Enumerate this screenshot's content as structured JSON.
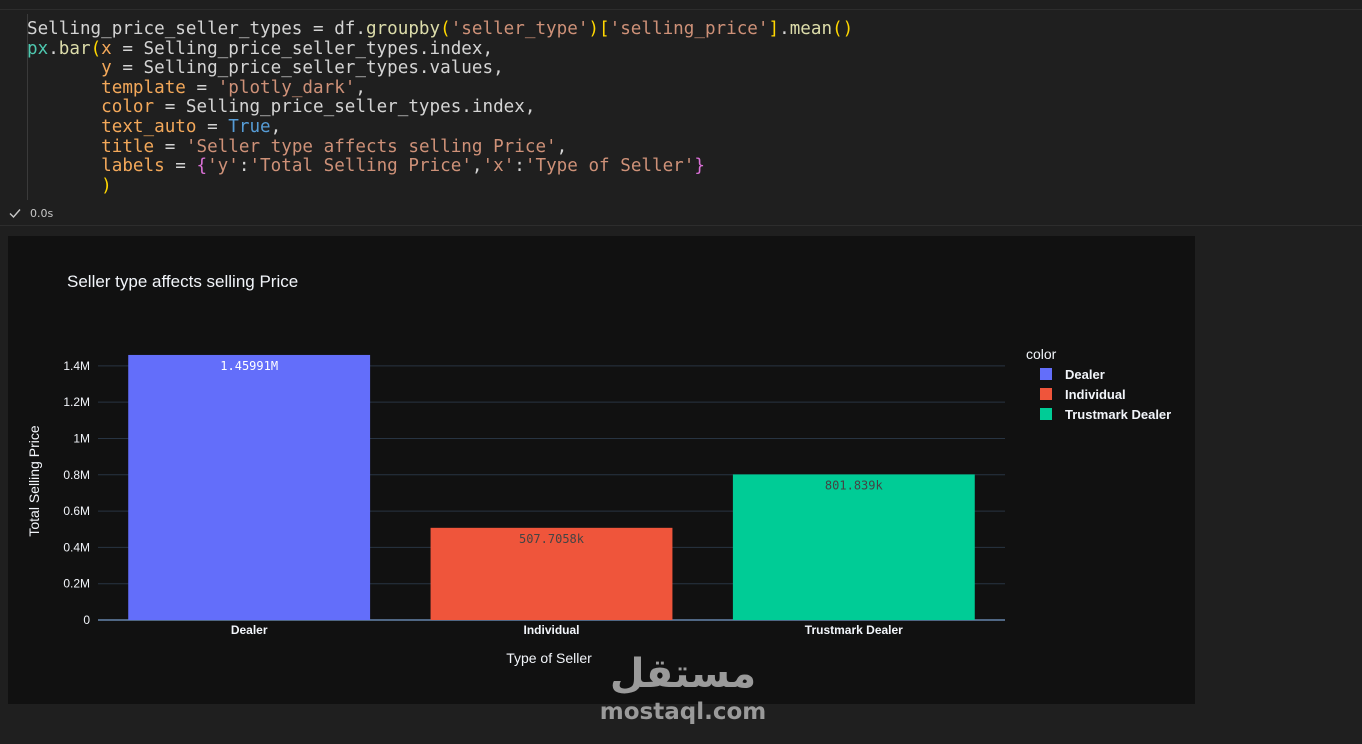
{
  "code": {
    "lines": [
      [
        {
          "t": "Selling_price_seller_types ",
          "c": "tok-var"
        },
        {
          "t": "= ",
          "c": "tok-var"
        },
        {
          "t": "df.",
          "c": "tok-var"
        },
        {
          "t": "groupby",
          "c": "tok-fn"
        },
        {
          "t": "(",
          "c": "tok-br1"
        },
        {
          "t": "'seller_type'",
          "c": "tok-str"
        },
        {
          "t": ")",
          "c": "tok-br1"
        },
        {
          "t": "[",
          "c": "tok-br1"
        },
        {
          "t": "'selling_price'",
          "c": "tok-str"
        },
        {
          "t": "]",
          "c": "tok-br1"
        },
        {
          "t": ".",
          "c": "tok-var"
        },
        {
          "t": "mean",
          "c": "tok-fn"
        },
        {
          "t": "()",
          "c": "tok-br1"
        }
      ],
      [
        {
          "t": "px",
          "c": "tok-py"
        },
        {
          "t": ".",
          "c": "tok-var"
        },
        {
          "t": "bar",
          "c": "tok-fn"
        },
        {
          "t": "(",
          "c": "tok-br1"
        },
        {
          "t": "x",
          "c": "tok-arg"
        },
        {
          "t": " = Selling_price_seller_types.index,",
          "c": "tok-var"
        }
      ],
      [
        {
          "t": "       ",
          "c": "tok-var"
        },
        {
          "t": "y",
          "c": "tok-arg"
        },
        {
          "t": " = Selling_price_seller_types.values,",
          "c": "tok-var"
        }
      ],
      [
        {
          "t": "       ",
          "c": "tok-var"
        },
        {
          "t": "template",
          "c": "tok-arg"
        },
        {
          "t": " = ",
          "c": "tok-var"
        },
        {
          "t": "'plotly_dark'",
          "c": "tok-str"
        },
        {
          "t": ",",
          "c": "tok-var"
        }
      ],
      [
        {
          "t": "       ",
          "c": "tok-var"
        },
        {
          "t": "color",
          "c": "tok-arg"
        },
        {
          "t": " = Selling_price_seller_types.index,",
          "c": "tok-var"
        }
      ],
      [
        {
          "t": "       ",
          "c": "tok-var"
        },
        {
          "t": "text_auto",
          "c": "tok-arg"
        },
        {
          "t": " = ",
          "c": "tok-var"
        },
        {
          "t": "True",
          "c": "tok-const"
        },
        {
          "t": ",",
          "c": "tok-var"
        }
      ],
      [
        {
          "t": "       ",
          "c": "tok-var"
        },
        {
          "t": "title",
          "c": "tok-arg"
        },
        {
          "t": " = ",
          "c": "tok-var"
        },
        {
          "t": "'Seller type affects selling Price'",
          "c": "tok-str"
        },
        {
          "t": ",",
          "c": "tok-var"
        }
      ],
      [
        {
          "t": "       ",
          "c": "tok-var"
        },
        {
          "t": "labels",
          "c": "tok-arg"
        },
        {
          "t": " = ",
          "c": "tok-var"
        },
        {
          "t": "{",
          "c": "tok-br2"
        },
        {
          "t": "'y'",
          "c": "tok-str"
        },
        {
          "t": ":",
          "c": "tok-var"
        },
        {
          "t": "'Total Selling Price'",
          "c": "tok-str"
        },
        {
          "t": ",",
          "c": "tok-var"
        },
        {
          "t": "'x'",
          "c": "tok-str"
        },
        {
          "t": ":",
          "c": "tok-var"
        },
        {
          "t": "'Type of Seller'",
          "c": "tok-str"
        },
        {
          "t": "}",
          "c": "tok-br2"
        }
      ],
      [
        {
          "t": "       ",
          "c": "tok-var"
        },
        {
          "t": ")",
          "c": "tok-br1"
        }
      ]
    ]
  },
  "status": {
    "duration": "0.0s",
    "icon": "check-icon"
  },
  "chart_data": {
    "type": "bar",
    "title": "Seller type affects selling Price",
    "xlabel": "Type of Seller",
    "ylabel": "Total Selling Price",
    "categories": [
      "Dealer",
      "Individual",
      "Trustmark Dealer"
    ],
    "values": [
      1459910,
      507705.8,
      801839
    ],
    "data_labels": [
      "1.45991M",
      "507.7058k",
      "801.839k"
    ],
    "colors": [
      "#636efa",
      "#ef553b",
      "#00cc96"
    ],
    "ylim": [
      0,
      1536748
    ],
    "yticks": [
      0,
      200000,
      400000,
      600000,
      800000,
      1000000,
      1200000,
      1400000
    ],
    "ytick_labels": [
      "0",
      "0.2M",
      "0.4M",
      "0.6M",
      "0.8M",
      "1M",
      "1.2M",
      "1.4M"
    ],
    "grid": true,
    "legend": {
      "title": "color",
      "placement": "right",
      "items": [
        "Dealer",
        "Individual",
        "Trustmark Dealer"
      ]
    }
  },
  "watermark": {
    "arabic": "مستقل",
    "latin": "mostaql.com"
  }
}
